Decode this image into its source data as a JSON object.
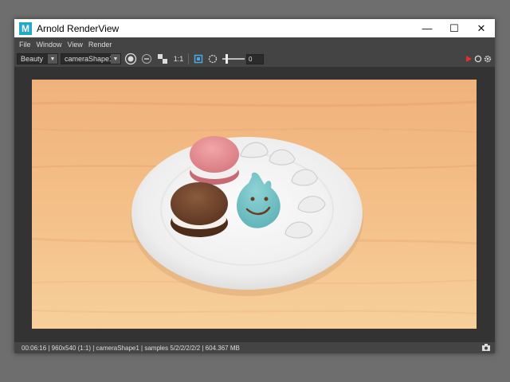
{
  "window": {
    "title": "Arnold RenderView",
    "app_icon_letter": "M",
    "controls": {
      "minimize": "—",
      "maximize": "☐",
      "close": "✕"
    }
  },
  "menu": {
    "items": [
      "File",
      "Window",
      "View",
      "Render"
    ]
  },
  "toolbar": {
    "aov_select": "Beauty",
    "camera_select": "cameraShape1",
    "ratio_label": "1:1",
    "exposure_value": "0",
    "icons": [
      "render-settings-icon",
      "rgb-channel-icon",
      "checker-icon",
      "ratio-label",
      "crop-region-icon",
      "exposure-icon",
      "exposure-slider"
    ],
    "right_icons": [
      "stop-render-icon",
      "refresh-render-icon",
      "settings-gear-icon"
    ],
    "accent_stop": "#e03030"
  },
  "statusbar": {
    "text": "00:06:16 | 960x540 (1:1) | cameraShape1 | samples 5/2/2/2/2/2 | 604.367 MB"
  },
  "render_scene": {
    "background": "wooden table",
    "objects": [
      "plate",
      "pink macaron",
      "chocolate macaron",
      "blue bunny cookie",
      "meringues"
    ]
  }
}
